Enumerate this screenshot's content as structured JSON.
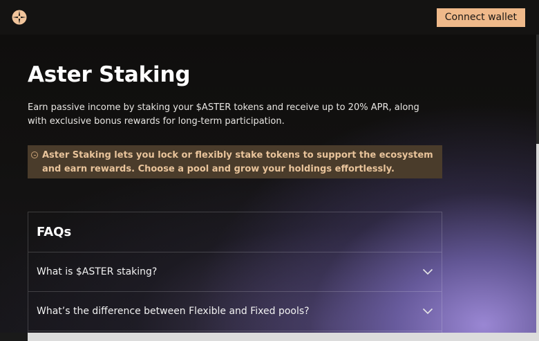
{
  "header": {
    "logo_icon": "aster-logo-icon",
    "connect_wallet_label": "Connect wallet",
    "accent_color": "#efb98a"
  },
  "page": {
    "title": "Aster Staking",
    "intro": "Earn passive income by staking your $ASTER tokens and receive up to 20% APR, along with exclusive bonus rewards for long-term participation.",
    "notice_icon": "info-circle-icon",
    "notice": "Aster Staking lets you lock or flexibly stake tokens to support the ecosystem and earn rewards. Choose a pool and grow your holdings effortlessly."
  },
  "faq": {
    "title": "FAQs",
    "items": [
      {
        "question": "What is $ASTER staking?",
        "icon": "chevron-down-icon"
      },
      {
        "question": "What’s the difference between Flexible and Fixed pools?",
        "icon": "chevron-down-icon"
      }
    ]
  }
}
